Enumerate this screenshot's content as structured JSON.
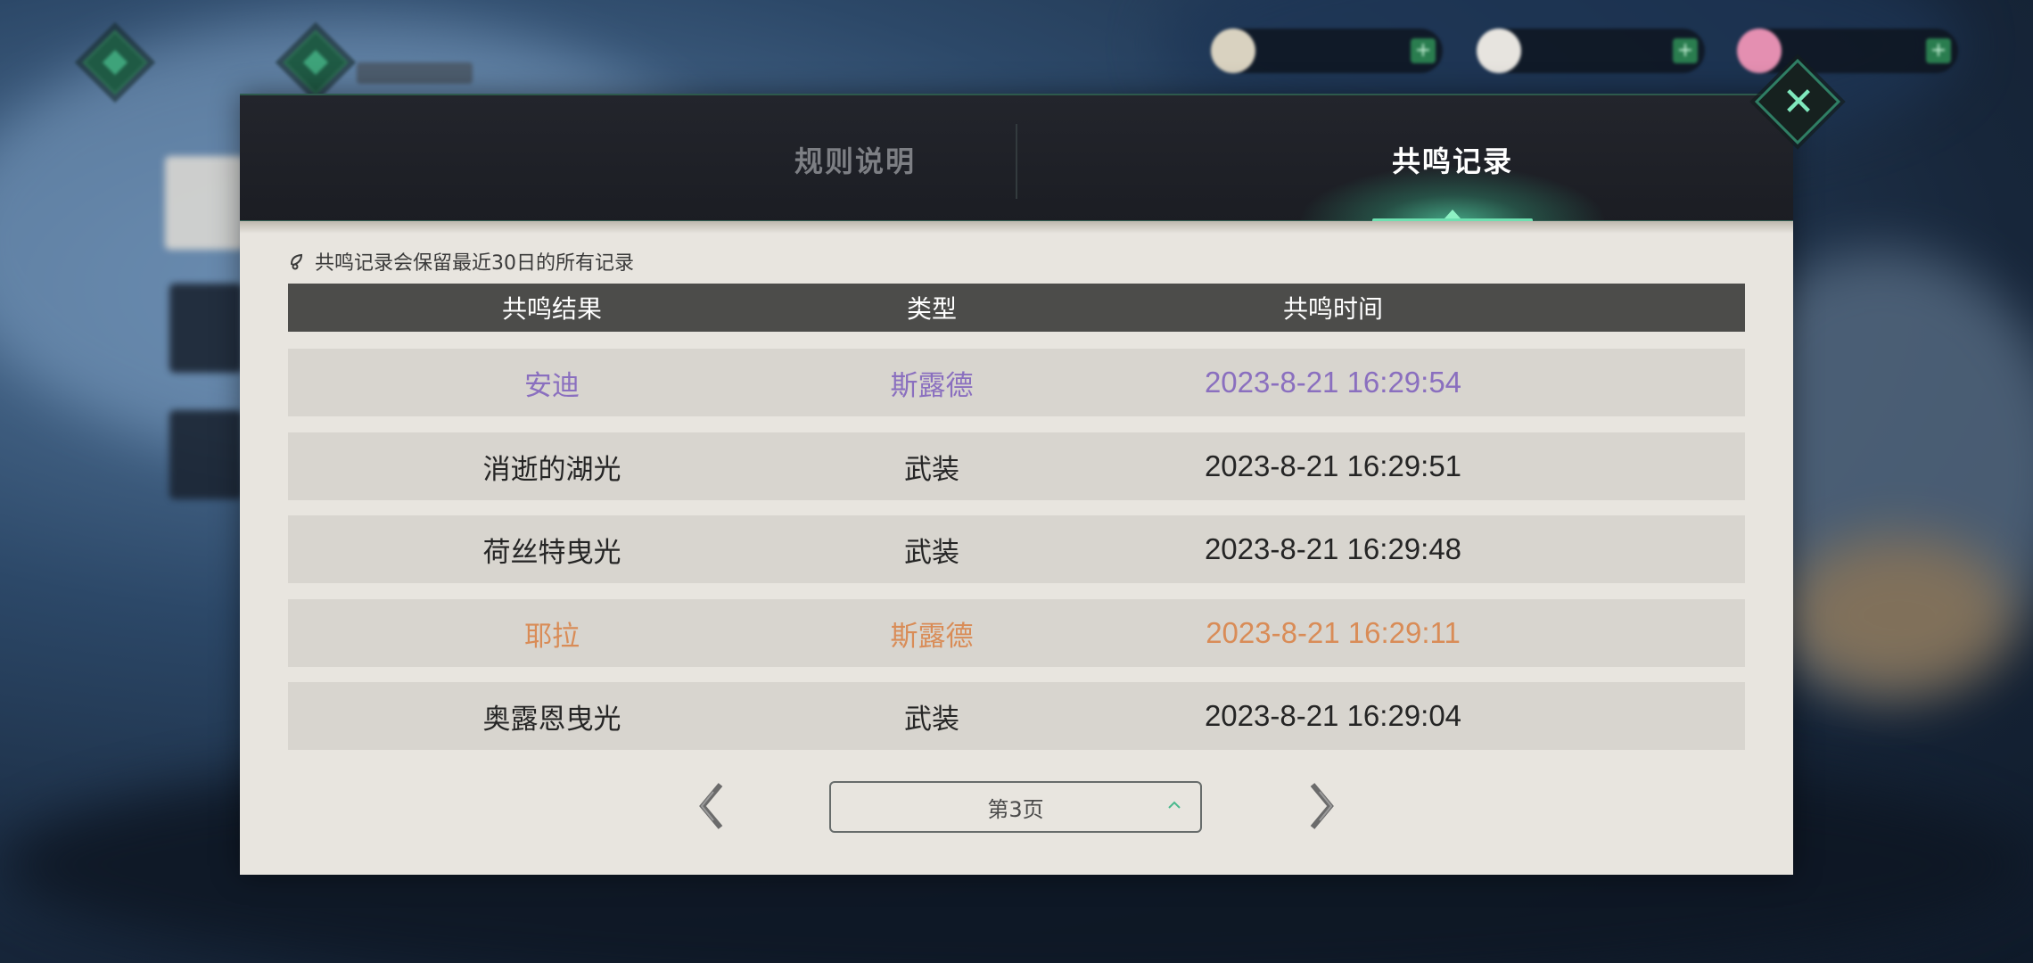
{
  "tabs": {
    "rules_label": "规则说明",
    "records_label": "共鸣记录",
    "active": "records"
  },
  "note": {
    "text": "共鸣记录会保留最近30日的所有记录"
  },
  "table": {
    "headers": [
      "共鸣结果",
      "类型",
      "共鸣时间"
    ],
    "rows": [
      {
        "result": "安迪",
        "type": "斯露德",
        "time": "2023-8-21 16:29:54",
        "rarity": "purple"
      },
      {
        "result": "消逝的湖光",
        "type": "武装",
        "time": "2023-8-21 16:29:51",
        "rarity": "normal"
      },
      {
        "result": "荷丝特曳光",
        "type": "武装",
        "time": "2023-8-21 16:29:48",
        "rarity": "normal"
      },
      {
        "result": "耶拉",
        "type": "斯露德",
        "time": "2023-8-21 16:29:11",
        "rarity": "orange"
      },
      {
        "result": "奥露恩曳光",
        "type": "武装",
        "time": "2023-8-21 16:29:04",
        "rarity": "normal"
      }
    ]
  },
  "pagination": {
    "current_page_label": "第3页"
  },
  "colors": {
    "accent": "#6ee0b1",
    "purple_rarity": "#8a6fbf",
    "orange_rarity": "#d98c57",
    "header_bg": "#4c4c4a",
    "row_bg": "#d8d5cf",
    "paper_bg": "#e8e5df"
  }
}
